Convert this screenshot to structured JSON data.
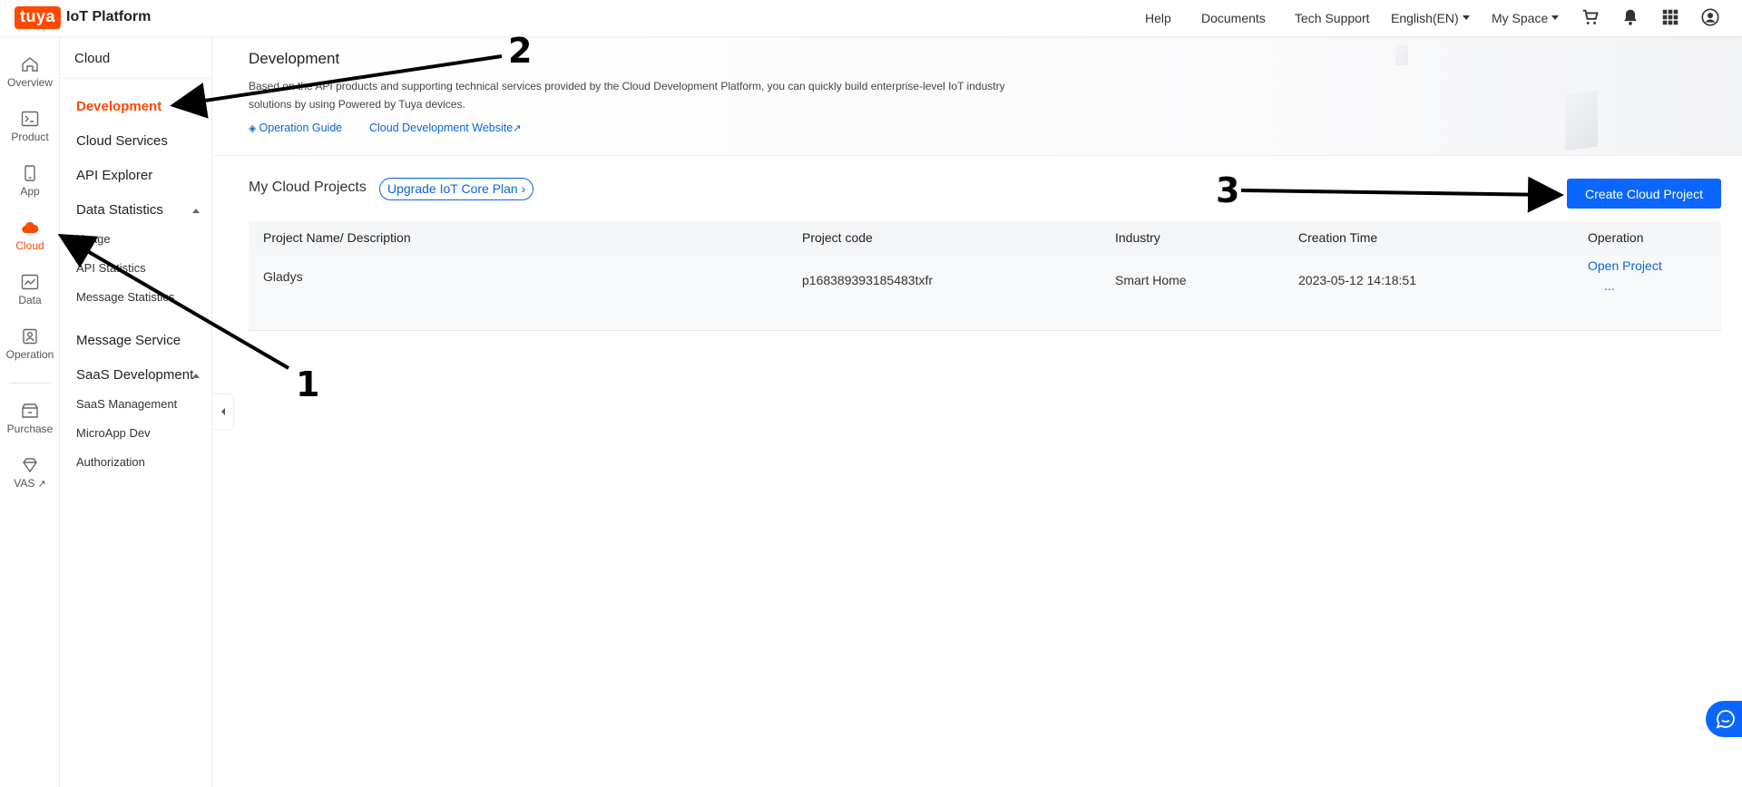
{
  "topbar": {
    "logo_badge": "tuya",
    "logo_text": "IoT Platform",
    "help": "Help",
    "documents": "Documents",
    "tech_support": "Tech Support",
    "language": "English(EN)",
    "space": "My Space"
  },
  "rail": {
    "overview": "Overview",
    "product": "Product",
    "app": "App",
    "cloud": "Cloud",
    "data": "Data",
    "operation": "Operation",
    "purchase": "Purchase",
    "vas": "VAS"
  },
  "sidebar": {
    "title": "Cloud",
    "development": "Development",
    "cloud_services": "Cloud Services",
    "api_explorer": "API Explorer",
    "data_statistics": "Data Statistics",
    "usage": "Usage",
    "api_statistics": "API Statistics",
    "message_statistics": "Message Statistics",
    "message_service": "Message Service",
    "saas_development": "SaaS Development",
    "saas_management": "SaaS Management",
    "microapp_dev": "MicroApp Dev",
    "authorization": "Authorization"
  },
  "banner": {
    "title": "Development",
    "description": "Based on the API products and supporting technical services provided by the Cloud Development Platform, you can quickly build enterprise-level IoT industry solutions by using Powered by Tuya devices.",
    "guide_link": "Operation Guide",
    "website_link": "Cloud Development Website"
  },
  "projects": {
    "title": "My Cloud Projects",
    "upgrade_label": "Upgrade IoT Core Plan",
    "create_label": "Create Cloud Project",
    "columns": [
      "Project Name/ Description",
      "Project code",
      "Industry",
      "Creation Time",
      "Operation"
    ],
    "rows": [
      {
        "name": "Gladys",
        "code": "p168389393185483txfr",
        "industry": "Smart Home",
        "created": "2023-05-12 14:18:51",
        "open": "Open Project",
        "more": "..."
      }
    ]
  },
  "annotations": [
    "1",
    "2",
    "3"
  ],
  "colors": {
    "brand": "#ff4800",
    "primary": "#0a66ff",
    "link": "#0a66d6"
  }
}
